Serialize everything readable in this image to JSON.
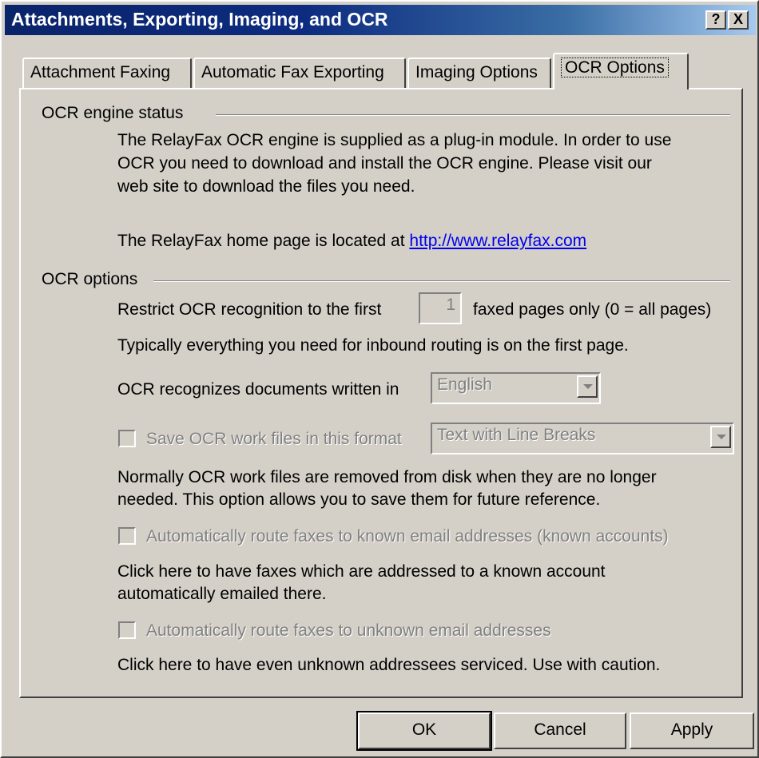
{
  "window": {
    "title": "Attachments, Exporting, Imaging, and OCR",
    "help_glyph": "?",
    "close_glyph": "X"
  },
  "tabs": [
    {
      "label": "Attachment Faxing",
      "active": false
    },
    {
      "label": "Automatic Fax Exporting",
      "active": false
    },
    {
      "label": "Imaging Options",
      "active": false
    },
    {
      "label": "OCR Options",
      "active": true
    }
  ],
  "engine_status": {
    "heading": "OCR engine status",
    "lines": [
      "The RelayFax OCR engine is supplied as a plug-in module.  In order to use",
      "OCR you need to download and install the OCR engine.  Please visit our",
      "web site to download the files you need."
    ],
    "homepage_prefix": "The RelayFax home page is located at",
    "homepage_link": "http://www.relayfax.com"
  },
  "ocr_options": {
    "heading": "OCR options",
    "restrict_prefix": "Restrict OCR recognition to the first",
    "restrict_value": "1",
    "restrict_suffix": "faxed pages only (0 = all pages)",
    "restrict_help": "Typically everything you need for inbound routing is on the first page.",
    "language_label": "OCR recognizes documents written in",
    "language_value": "English",
    "save_label": "Save OCR work files in this format",
    "save_format_value": "Text with Line Breaks",
    "save_help": [
      "Normally OCR work files are removed from disk when they are no longer",
      "needed.  This option allows you to save them for future reference."
    ],
    "route_known_label": "Automatically route faxes to known email addresses (known accounts)",
    "route_known_help": [
      "Click here to have faxes which are addressed to a known account",
      "automatically emailed there."
    ],
    "route_unknown_label": "Automatically route faxes to unknown email addresses",
    "route_unknown_help": "Click here to have even unknown addressees serviced.  Use with caution."
  },
  "buttons": {
    "ok": "OK",
    "cancel": "Cancel",
    "apply": "Apply"
  }
}
